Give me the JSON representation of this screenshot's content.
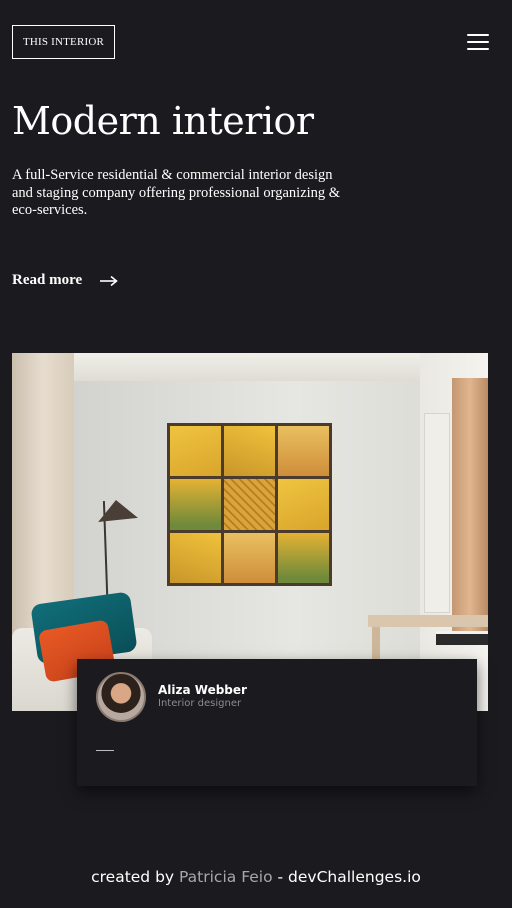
{
  "header": {
    "logo": "THIS INTERIOR",
    "menu_icon": "hamburger-menu-icon"
  },
  "hero": {
    "title": "Modern interior",
    "description": "A full-Service residential & commercial interior design and staging company offering professional organizing & eco-services.",
    "read_more": "Read more",
    "read_more_icon": "arrow-right-icon"
  },
  "photo": {
    "subject": "living-room-interior-photo"
  },
  "designer": {
    "name": "Aliza Webber",
    "role": "Interior designer"
  },
  "footer": {
    "prefix": "created by",
    "author": "Patricia Feio",
    "separator": " - ",
    "site": "devChallenges.io"
  },
  "colors": {
    "background": "#1b1a1e",
    "text": "#ffffff",
    "muted": "#8d8c8f"
  }
}
